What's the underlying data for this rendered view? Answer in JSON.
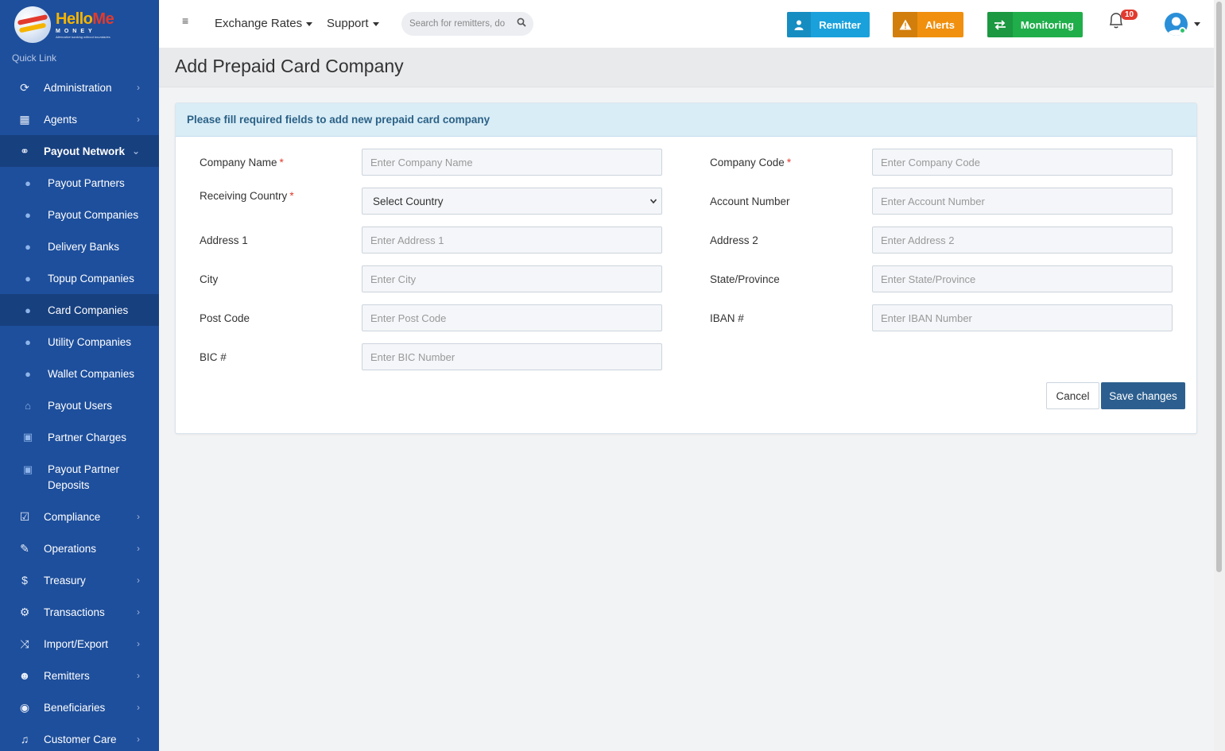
{
  "app": {
    "brand_hello": "Hello",
    "brand_me": "Me",
    "brand_money": "MONEY",
    "brand_tagline": "Alternative banking without boundaries"
  },
  "sidebar": {
    "quick_link": "Quick Link",
    "items_top": [
      {
        "label": "Administration",
        "icon": "cog-icon"
      },
      {
        "label": "Agents",
        "icon": "building-icon"
      },
      {
        "label": "Payout Network",
        "icon": "handshake-icon"
      }
    ],
    "sub_items": [
      {
        "label": "Payout Partners",
        "icon": "user-icon"
      },
      {
        "label": "Payout Companies",
        "icon": "user-icon"
      },
      {
        "label": "Delivery Banks",
        "icon": "user-icon"
      },
      {
        "label": "Topup Companies",
        "icon": "user-icon"
      },
      {
        "label": "Card Companies",
        "icon": "user-icon",
        "active": true
      },
      {
        "label": "Utility Companies",
        "icon": "user-icon"
      },
      {
        "label": "Wallet Companies",
        "icon": "user-icon"
      },
      {
        "label": "Payout Users",
        "icon": "bank-icon"
      },
      {
        "label": "Partner Charges",
        "icon": "money-icon"
      },
      {
        "label": "Payout Partner Deposits",
        "icon": "money-icon"
      }
    ],
    "items_bottom": [
      {
        "label": "Compliance",
        "icon": "check-square-icon"
      },
      {
        "label": "Operations",
        "icon": "wrench-icon"
      },
      {
        "label": "Treasury",
        "icon": "dollar-icon"
      },
      {
        "label": "Transactions",
        "icon": "cogs-icon"
      },
      {
        "label": "Import/Export",
        "icon": "shuffle-icon"
      },
      {
        "label": "Remitters",
        "icon": "users-icon"
      },
      {
        "label": "Beneficiaries",
        "icon": "user-circle-icon"
      },
      {
        "label": "Customer Care",
        "icon": "headset-icon"
      }
    ]
  },
  "topbar": {
    "menu_exchange_rates": "Exchange Rates",
    "menu_support": "Support",
    "search_placeholder": "Search for remitters, do",
    "btn_remitter": "Remitter",
    "btn_alerts": "Alerts",
    "btn_monitoring": "Monitoring",
    "notification_count": "10",
    "colors": {
      "remitter": "#1aa1dc",
      "alerts": "#f0900e",
      "monitoring": "#1fae4a",
      "badge": "#e23a2e"
    }
  },
  "page": {
    "title": "Add Prepaid Card Company"
  },
  "form": {
    "header": "Please fill required fields to add new prepaid card company",
    "company_name_label": "Company Name",
    "company_name_placeholder": "Enter Company Name",
    "company_code_label": "Company Code",
    "company_code_placeholder": "Enter Company Code",
    "receiving_country_label": "Receiving Country",
    "receiving_country_selected": "Select Country",
    "account_number_label": "Account Number",
    "account_number_placeholder": "Enter Account Number",
    "address1_label": "Address 1",
    "address1_placeholder": "Enter Address 1",
    "address2_label": "Address 2",
    "address2_placeholder": "Enter Address 2",
    "city_label": "City",
    "city_placeholder": "Enter City",
    "state_label": "State/Province",
    "state_placeholder": "Enter State/Province",
    "postcode_label": "Post Code",
    "postcode_placeholder": "Enter Post Code",
    "iban_label": "IBAN #",
    "iban_placeholder": "Enter IBAN Number",
    "bic_label": "BIC #",
    "bic_placeholder": "Enter BIC Number",
    "required_mark": "*",
    "cancel_label": "Cancel",
    "save_label": "Save changes"
  }
}
